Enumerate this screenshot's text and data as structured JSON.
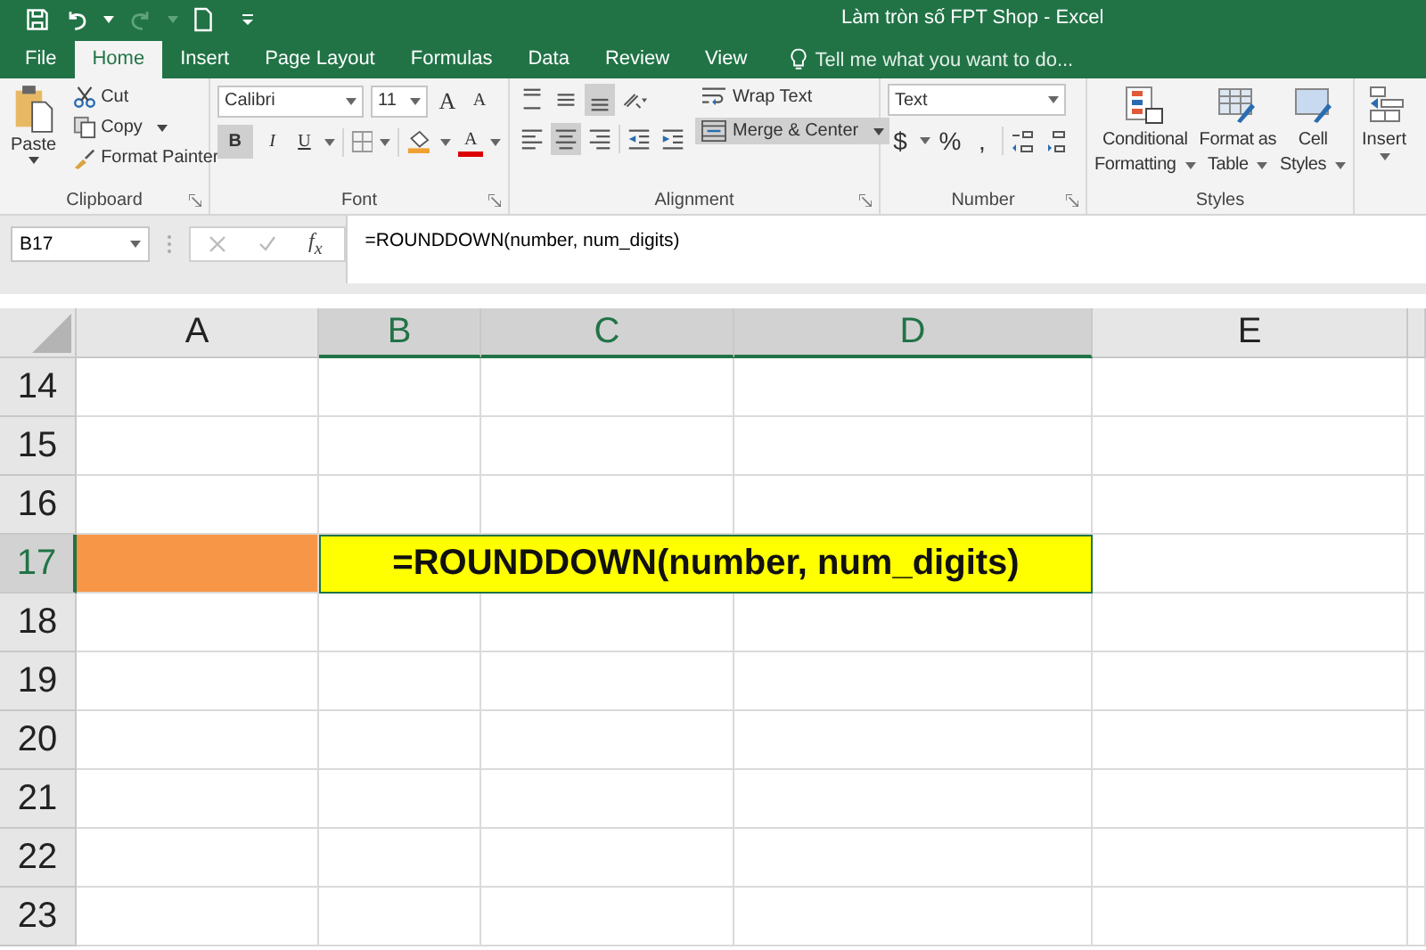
{
  "window": {
    "title": "Làm tròn số FPT Shop - Excel"
  },
  "tabs": [
    {
      "label": "File",
      "selected": false
    },
    {
      "label": "Home",
      "selected": true
    },
    {
      "label": "Insert",
      "selected": false
    },
    {
      "label": "Page Layout",
      "selected": false
    },
    {
      "label": "Formulas",
      "selected": false
    },
    {
      "label": "Data",
      "selected": false
    },
    {
      "label": "Review",
      "selected": false
    },
    {
      "label": "View",
      "selected": false
    }
  ],
  "tell_me": {
    "placeholder": "Tell me what you want to do..."
  },
  "clipboard": {
    "label": "Clipboard",
    "paste": "Paste",
    "cut": "Cut",
    "copy": "Copy",
    "format_painter": "Format Painter"
  },
  "font": {
    "label": "Font",
    "family": "Calibri",
    "size": "11",
    "grow": "A",
    "shrink": "A",
    "bold": "B",
    "bold_on": true,
    "italic": "I",
    "underline": "U",
    "font_color": "A"
  },
  "alignment": {
    "label": "Alignment",
    "vertical": [
      {
        "selected": false
      },
      {
        "selected": false
      },
      {
        "selected": true
      }
    ],
    "horizontal": [
      {
        "selected": false
      },
      {
        "selected": true
      },
      {
        "selected": false
      }
    ],
    "wrap_text": "Wrap Text",
    "merge_center": "Merge & Center",
    "merge_on": true
  },
  "number": {
    "label": "Number",
    "format": "Text",
    "currency": "$",
    "percent": "%",
    "comma": ","
  },
  "styles": {
    "label": "Styles",
    "items": [
      {
        "kind": "conditional",
        "line1": "Conditional",
        "line2": "Formatting"
      },
      {
        "kind": "table",
        "line1": "Format as",
        "line2": "Table"
      },
      {
        "kind": "cell",
        "line1": "Cell",
        "line2": "Styles"
      }
    ]
  },
  "cells": {
    "insert": "Insert"
  },
  "formula_bar": {
    "name_box": "B17",
    "fx": "f$_{x}$",
    "formula": "=ROUNDDOWN(number, num_digits)"
  },
  "columns": [
    {
      "label": "A",
      "selected": false
    },
    {
      "label": "B",
      "selected": true
    },
    {
      "label": "C",
      "selected": true
    },
    {
      "label": "D",
      "selected": true
    },
    {
      "label": "E",
      "selected": false
    }
  ],
  "rows": [
    {
      "label": "14",
      "selected": false
    },
    {
      "label": "15",
      "selected": false
    },
    {
      "label": "16",
      "selected": false
    },
    {
      "label": "17",
      "selected": true,
      "color": "#f79646",
      "merged_text": "=ROUNDDOWN(number, num_digits)"
    },
    {
      "label": "18",
      "selected": false
    },
    {
      "label": "19",
      "selected": false
    },
    {
      "label": "20",
      "selected": false
    },
    {
      "label": "21",
      "selected": false
    },
    {
      "label": "22",
      "selected": false
    },
    {
      "label": "23",
      "selected": false
    }
  ]
}
